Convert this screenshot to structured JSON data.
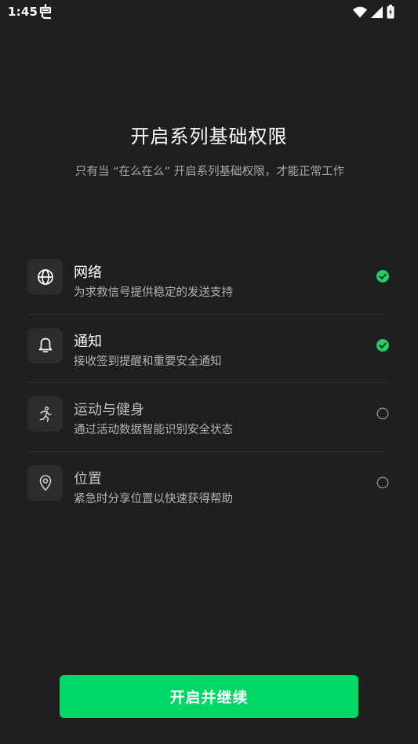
{
  "status_bar": {
    "time": "1:45",
    "icons": [
      "app-notification-icon",
      "wifi-icon",
      "signal-icon",
      "battery-icon"
    ]
  },
  "header": {
    "title": "开启系列基础权限",
    "subtitle": "只有当 “在么在么” 开启系列基础权限，才能正常工作"
  },
  "permissions": [
    {
      "name": "网络",
      "description": "为求救信号提供稳定的发送支持",
      "icon": "globe-icon",
      "granted": true
    },
    {
      "name": "通知",
      "description": "接收签到提醒和重要安全通知",
      "icon": "bell-icon",
      "granted": true
    },
    {
      "name": "运动与健身",
      "description": "通过活动数据智能识别安全状态",
      "icon": "running-person-icon",
      "granted": false
    },
    {
      "name": "位置",
      "description": "紧急时分享位置以快速获得帮助",
      "icon": "location-pin-icon",
      "granted": false
    }
  ],
  "action": {
    "label": "开启并继续"
  },
  "colors": {
    "background": "#1f1f1f",
    "accent": "#00d866",
    "granted_check": "#22cc66",
    "icon_box": "#2c2c2c"
  }
}
